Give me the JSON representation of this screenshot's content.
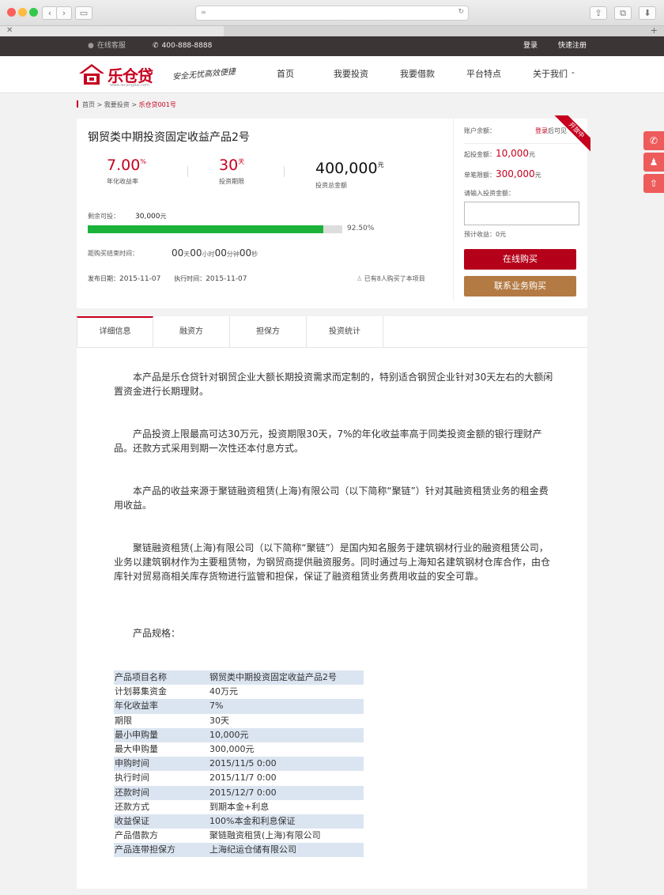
{
  "browser": {},
  "topbar": {
    "service": "在线客服",
    "phone": "400-888-8888",
    "login": "登录",
    "register": "快速注册"
  },
  "header": {
    "logo_text": "乐仓贷",
    "logo_sub": "www.lecangdai.com",
    "slogan": "安全无忧高效便捷",
    "nav": [
      "首页",
      "我要投资",
      "我要借款",
      "平台特点",
      "关于我们"
    ]
  },
  "breadcrumb": [
    "首页",
    "我要投资",
    "乐仓贷001号"
  ],
  "product": {
    "title": "钢贸类中期投资固定收益产品2号",
    "ribbon": "开放中",
    "rate": "7.00",
    "rate_unit": "%",
    "rate_label": "年化收益率",
    "term": "30",
    "term_unit": "天",
    "term_label": "投资期限",
    "total": "400,000",
    "total_unit": "元",
    "total_label": "投资总金额",
    "remain_label": "剩余可投：",
    "remain_value": "30,000",
    "remain_unit": "元",
    "progress_pct": 92.5,
    "progress_text": "92.50%",
    "countdown_label": "距购买结束时间：",
    "countdown": {
      "days": "00",
      "d": "天",
      "hours": "00",
      "h": "小时",
      "mins": "00",
      "m": "分钟",
      "secs": "00",
      "s": "秒"
    },
    "publish_label": "发布日期：",
    "publish_date": "2015-11-07",
    "exec_label": "执行时间：",
    "exec_date": "2015-11-07",
    "buyers_text": "已有8人购买了本项目"
  },
  "sidebar": {
    "balance_label": "账户余额：",
    "balance_login": "登录",
    "balance_suffix": "后可见",
    "min_label": "起投金额：",
    "min_value": "10,000",
    "max_label": "单笔限额：",
    "max_value": "300,000",
    "unit": "元",
    "input_label": "请输入投资金额：",
    "expected_label": "预计收益：",
    "expected_value": "0元",
    "buy_button": "在线购买",
    "contact_button": "联系业务购买"
  },
  "tabs": [
    "详细信息",
    "融资方",
    "担保方",
    "投资统计"
  ],
  "content": {
    "paragraphs": [
      "本产品是乐仓贷针对钢贸企业大额长期投资需求而定制的，特别适合钢贸企业针对30天左右的大额闲置资金进行长期理财。",
      "产品投资上限最高可达30万元，投资期限30天，7%的年化收益率高于同类投资金额的银行理财产品。还款方式采用到期一次性还本付息方式。",
      "本产品的收益来源于聚链融资租赁(上海)有限公司（以下简称“聚链”）针对其融资租赁业务的租金费用收益。",
      "聚链融资租赁(上海)有限公司（以下简称“聚链”）是国内知名服务于建筑钢材行业的融资租赁公司，业务以建筑钢材作为主要租赁物，为钢贸商提供融资服务。同时通过与上海知名建筑钢材仓库合作，由仓库针对贸易商相关库存货物进行监管和担保，保证了融资租赁业务费用收益的安全可靠。"
    ],
    "spec_title": "产品规格：",
    "spec": [
      [
        "产品项目名称",
        "钢贸类中期投资固定收益产品2号"
      ],
      [
        "计划募集资金",
        "40万元"
      ],
      [
        "年化收益率",
        "7%"
      ],
      [
        "期限",
        "30天"
      ],
      [
        "最小申购量",
        "10,000元"
      ],
      [
        "最大申购量",
        "300,000元"
      ],
      [
        "申购时间",
        "2015/11/5  0:00"
      ],
      [
        "执行时间",
        "2015/11/7    0:00"
      ],
      [
        "还款时间",
        "2015/12/7  0:00"
      ],
      [
        "还款方式",
        "到期本金+利息"
      ],
      [
        "收益保证",
        "100%本金和利息保证"
      ],
      [
        "产品借款方",
        "聚链融资租赁(上海)有限公司"
      ],
      [
        "产品连带担保方",
        "上海纪运仓储有限公司"
      ]
    ]
  },
  "colors": {
    "brand": "#c6001e",
    "progress": "#1bb23a",
    "contact": "#b47a43",
    "spec_row": "#dbe5f1"
  }
}
